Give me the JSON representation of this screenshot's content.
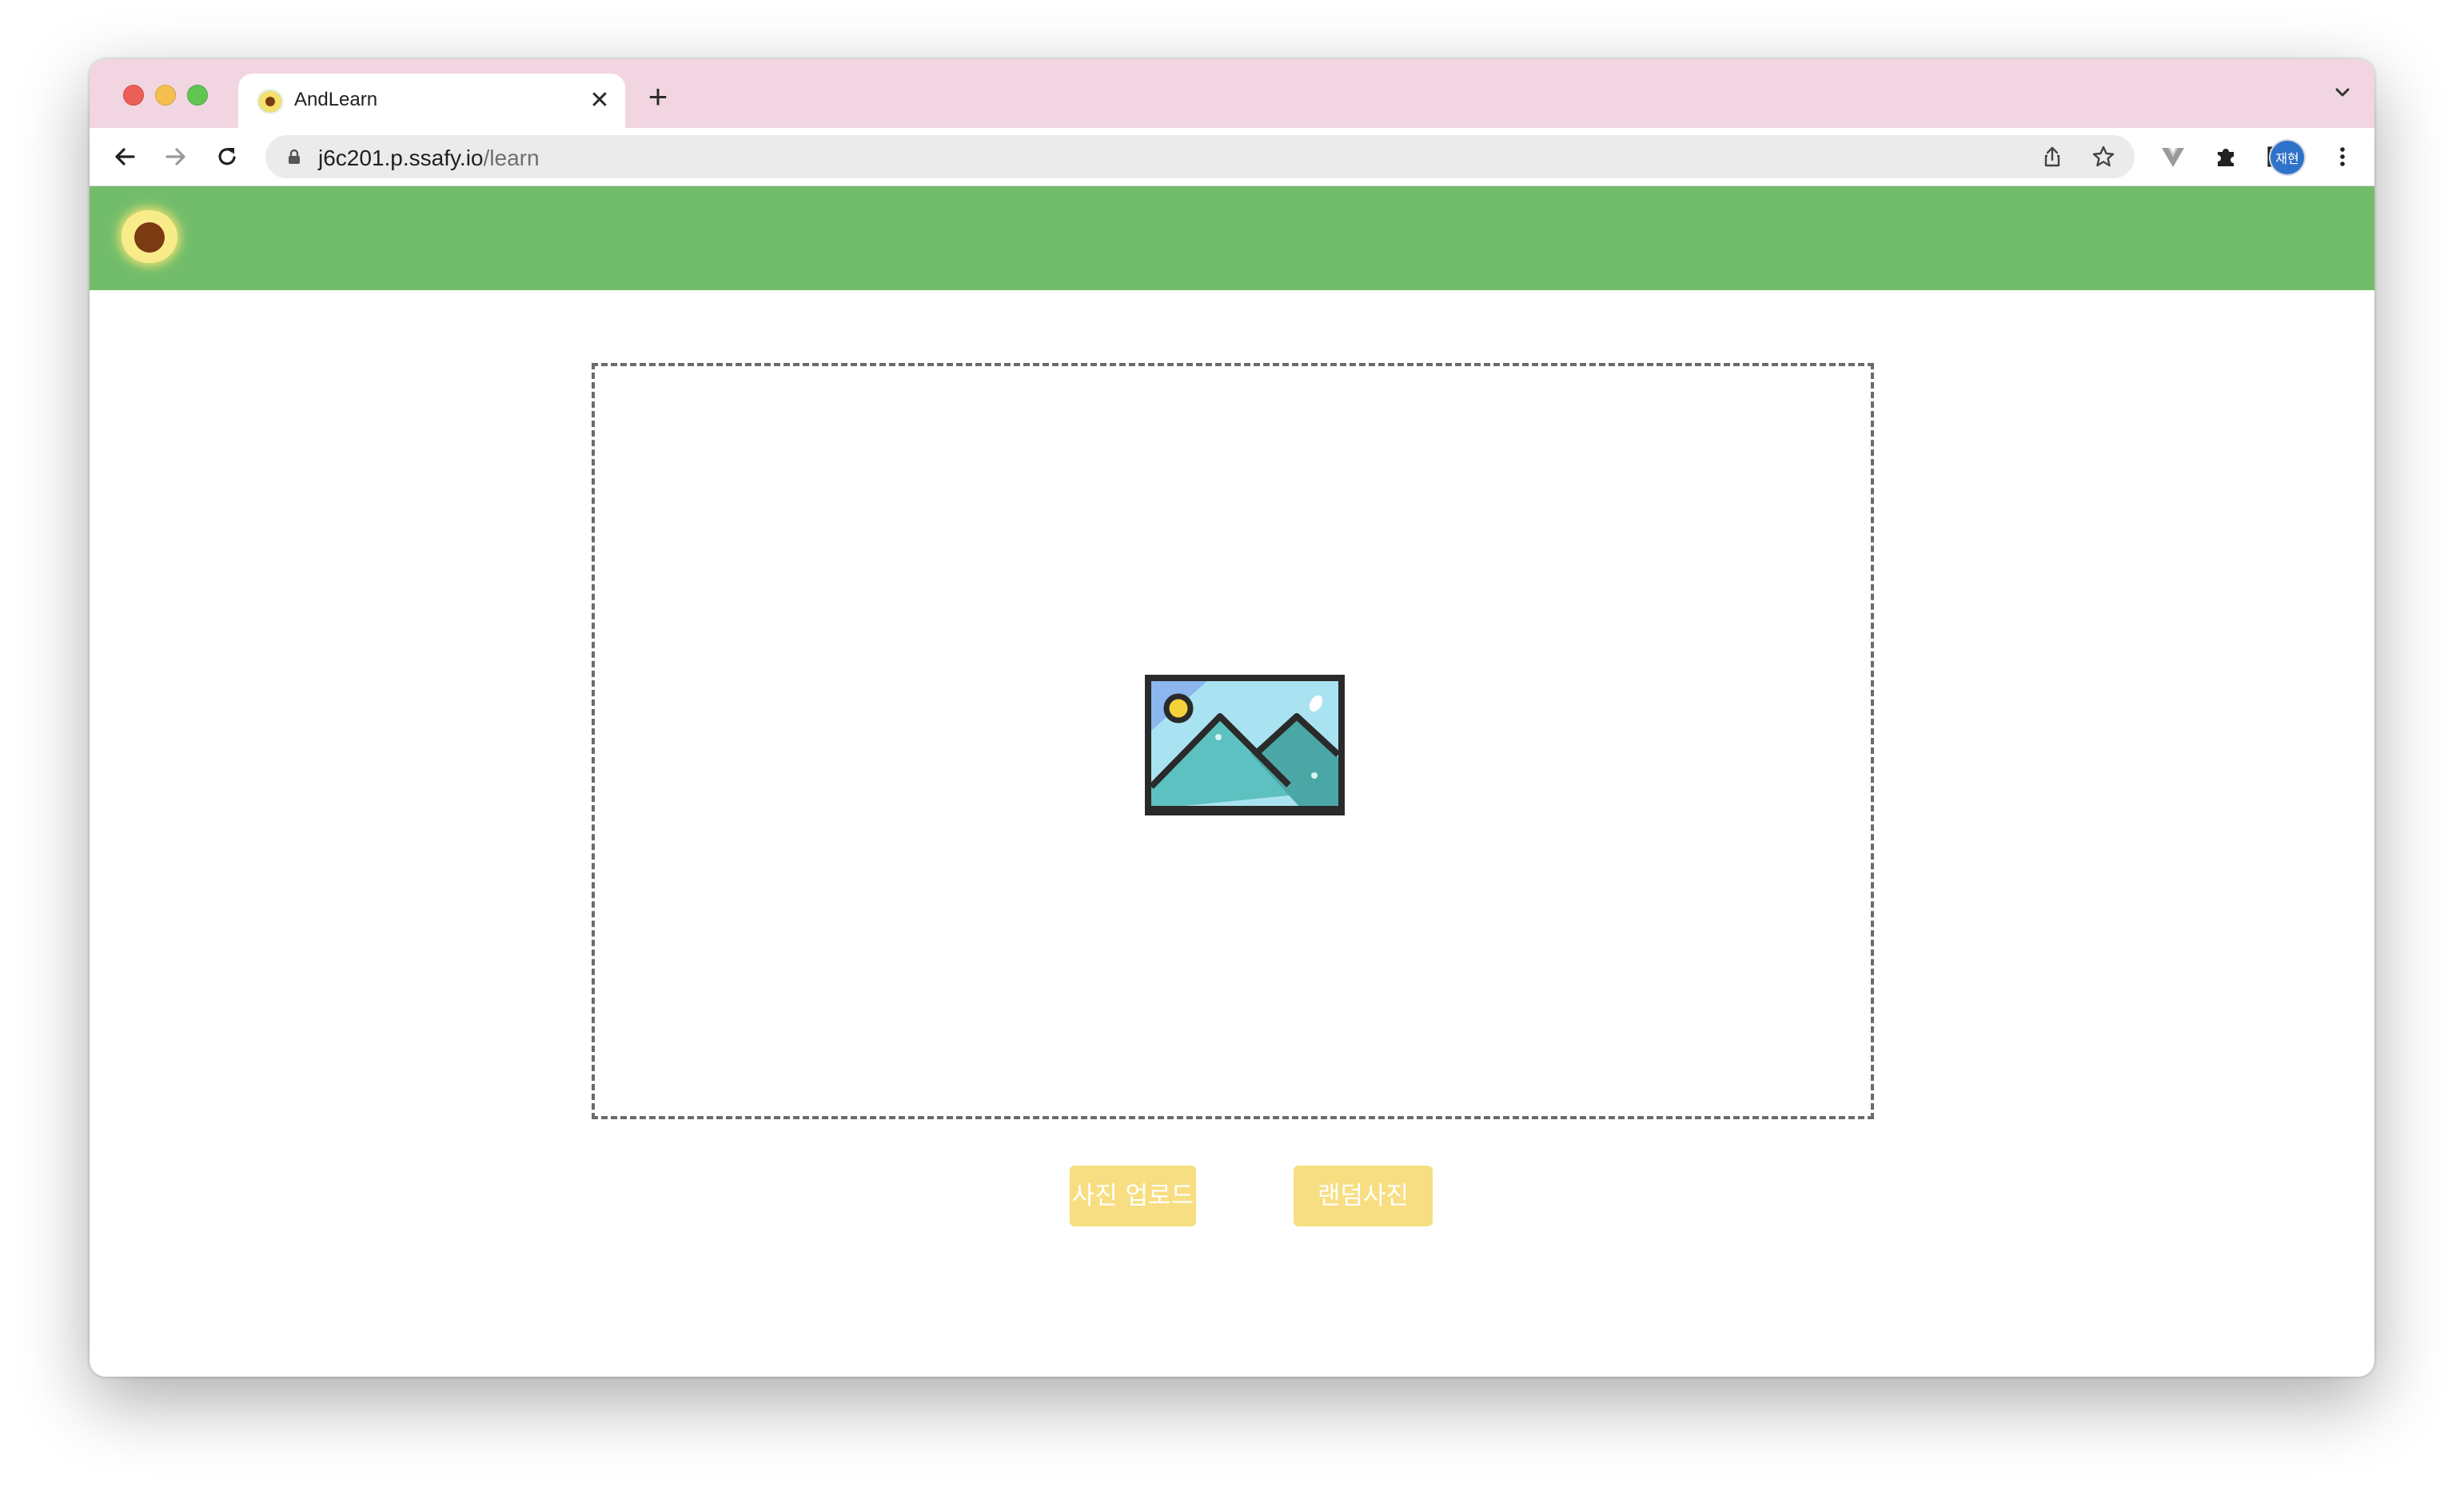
{
  "browser": {
    "tab": {
      "title": "AndLearn",
      "close_glyph": "✕"
    },
    "new_tab_glyph": "+",
    "address_bar": {
      "host": "j6c201.p.ssafy.io",
      "path": "/learn"
    },
    "profile": {
      "label": "재현",
      "color": "#2f72c9"
    },
    "tabstrip_color": "#f1d6e2"
  },
  "app": {
    "header_color": "#72bd6b",
    "logo_icon": "avocado-logo-icon",
    "dropzone": {
      "placeholder_icon": "image-placeholder-icon"
    },
    "buttons": {
      "upload_label": "사진 업로드",
      "random_label": "랜덤사진",
      "color": "#f7de82"
    }
  }
}
